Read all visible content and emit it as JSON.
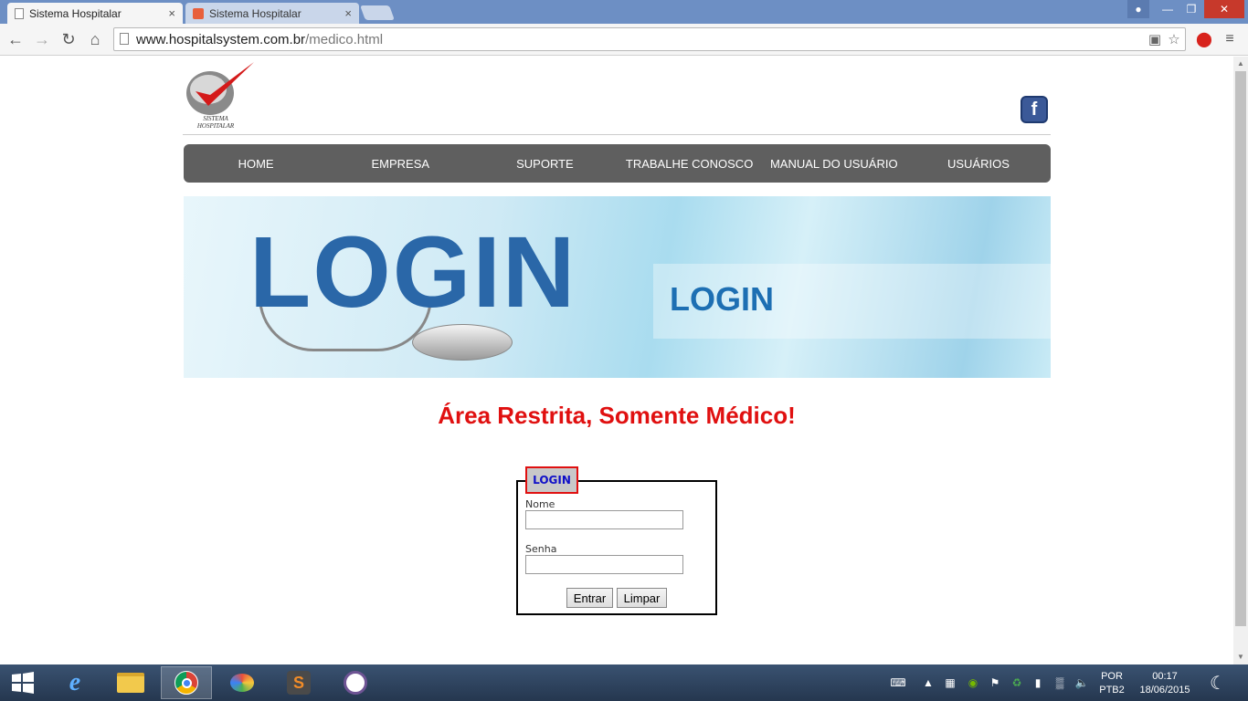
{
  "browser": {
    "tabs": [
      {
        "title": "Sistema Hospitalar",
        "active": true
      },
      {
        "title": "Sistema Hospitalar",
        "active": false
      }
    ],
    "close_glyph": "×",
    "url_host": "www.hospitalsystem.com.br",
    "url_path": "/medico.html"
  },
  "site": {
    "logo_text": "SISTEMA HOSPITALAR",
    "facebook_glyph": "f",
    "menu": [
      "HOME",
      "EMPRESA",
      "SUPORTE",
      "TRABALHE CONOSCO",
      "MANUAL DO USUÁRIO",
      "USUÁRIOS"
    ],
    "banner_big": "LOGIN",
    "banner_small": "LOGIN",
    "restricted_message": "Área Restrita, Somente Médico!"
  },
  "form": {
    "legend": "LOGIN",
    "name_label": "Nome",
    "name_value": "",
    "password_label": "Senha",
    "password_value": "",
    "submit_label": "Entrar",
    "reset_label": "Limpar"
  },
  "taskbar": {
    "lang_top": "POR",
    "lang_bottom": "PTB2",
    "time": "00:17",
    "date": "18/06/2015"
  }
}
